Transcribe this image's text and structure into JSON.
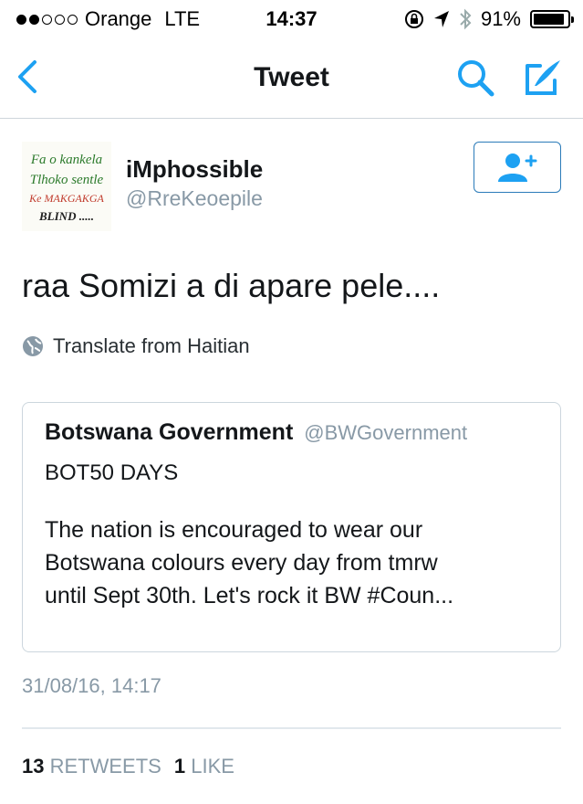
{
  "status_bar": {
    "carrier": "Orange",
    "network": "LTE",
    "time": "14:37",
    "battery": "91%",
    "battery_level": 0.91,
    "signal_bars": 2
  },
  "nav": {
    "title": "Tweet",
    "back_icon": "chevron-left-icon",
    "search_icon": "search-icon",
    "compose_icon": "compose-icon",
    "accent": "#1da1f2"
  },
  "tweet": {
    "author_name": "iMphossible",
    "author_handle": "@RreKeoepile",
    "avatar_lines": [
      "Fa o kankela",
      "Tlhoko sentle",
      "Ke MAKGAKGA",
      "BLIND ....."
    ],
    "text": "raa Somizi a di apare pele....",
    "translate": "Translate from Haitian",
    "timestamp": "31/08/16, 14:17",
    "retweets_count": "13",
    "retweets_label": "RETWEETS",
    "likes_count": "1",
    "likes_label": "LIKE"
  },
  "quote": {
    "name": "Botswana Government",
    "handle": "@BWGovernment",
    "line1": "BOT50 DAYS",
    "body_lines": [
      "The nation is encouraged to wear our",
      "Botswana colours every day from tmrw",
      "until Sept 30th. Let's rock it BW #Coun..."
    ]
  }
}
